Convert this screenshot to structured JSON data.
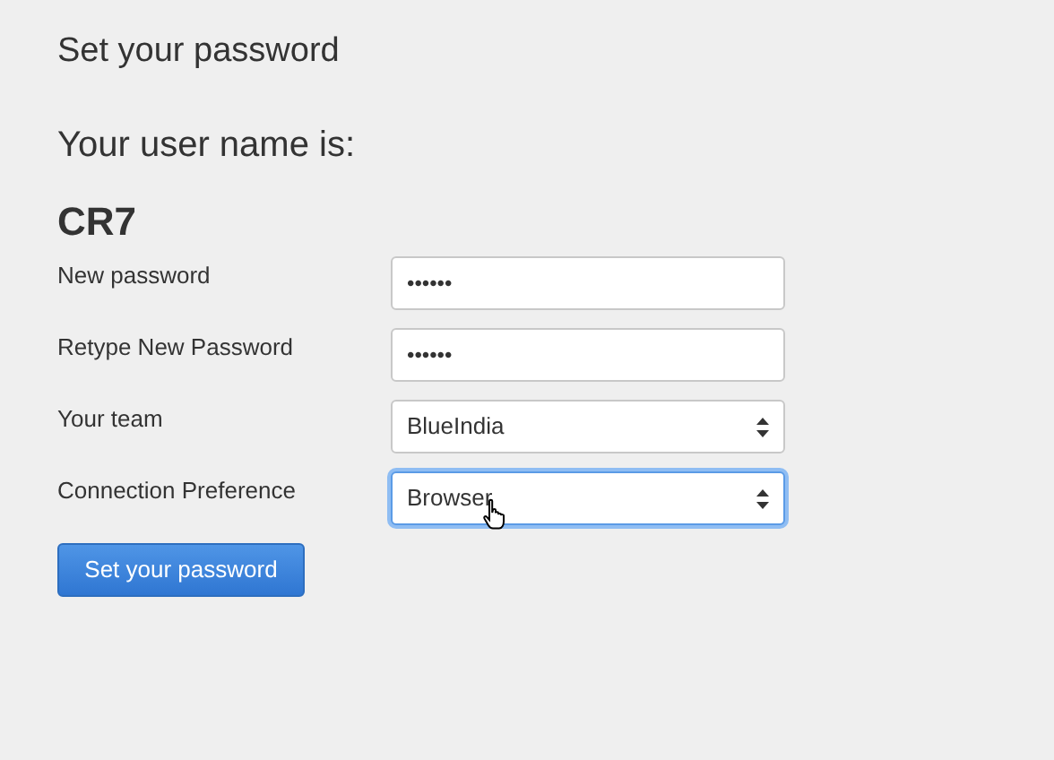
{
  "title": "Set your password",
  "username_label": "Your user name is:",
  "username": "CR7",
  "fields": [
    {
      "kind": "password",
      "label": "New password",
      "value": "••••••",
      "focused": false
    },
    {
      "kind": "password",
      "label": "Retype New Password",
      "value": "••••••",
      "focused": false
    },
    {
      "kind": "select",
      "label": "Your team",
      "value": "BlueIndia",
      "focused": false
    },
    {
      "kind": "select",
      "label": "Connection Preference",
      "value": "Browser",
      "focused": true
    }
  ],
  "submit": "Set your password"
}
